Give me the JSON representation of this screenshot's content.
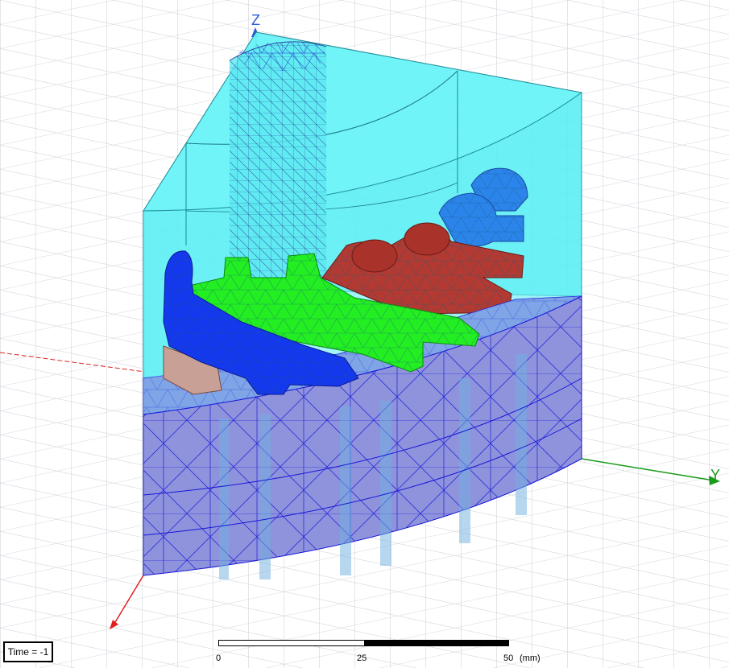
{
  "viewport": {
    "axes": {
      "z_label": "Z",
      "y_label": "Y"
    },
    "colors": {
      "grid": "#c9cdd4",
      "air_region": "#5ff0f5",
      "air_edge": "#1a8a96",
      "base_side": "#8f93dc",
      "base_top": "#7fa5e6",
      "mesh": "#1515d8",
      "blue_coil": "#1438ee",
      "green_coil": "#22ee22",
      "red_coil": "#b33a32",
      "light_blue_coil": "#2a84ea",
      "tan_part": "#c9a096",
      "axis_x": "#e02020",
      "axis_y": "#1a9a1a",
      "axis_z": "#2a5ad8"
    }
  },
  "status": {
    "time_label": "Time = -1"
  },
  "scale_bar": {
    "ticks": [
      "0",
      "25",
      "50"
    ],
    "unit": "(mm)"
  }
}
